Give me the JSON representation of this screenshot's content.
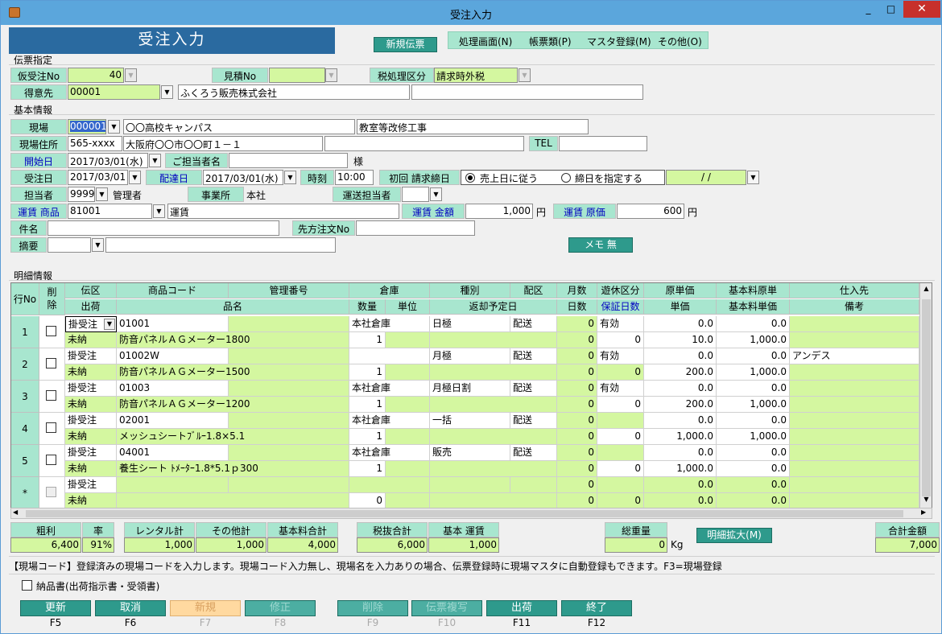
{
  "window": {
    "title": "受注入力",
    "minimize": "_",
    "maximize": "□",
    "close": "✕"
  },
  "header": {
    "banner": "受注入力",
    "new_slip": "新規伝票"
  },
  "menu": [
    "処理画面(N)",
    "帳票類(P)",
    "マスタ登録(M)",
    "その他(O)"
  ],
  "sections": {
    "slip": "伝票指定",
    "basic": "基本情報",
    "detail": "明細情報"
  },
  "slip": {
    "temp_order_no_label": "仮受注No",
    "temp_order_no": "40",
    "estimate_no_label": "見積No",
    "estimate_no": "",
    "tax_label": "税処理区分",
    "tax_value": "請求時外税",
    "customer_label": "得意先",
    "customer_code": "00001",
    "customer_name": "ふくろう販売株式会社",
    "customer_extra": ""
  },
  "basic": {
    "site_label": "現場",
    "site_code": "000001",
    "site_name": "〇〇高校キャンパス",
    "site_work": "教室等改修工事",
    "site_addr_label": "現場住所",
    "zip": "565-xxxx",
    "address": "大阪府〇〇市〇〇町１－１",
    "address2": "",
    "tel_label": "TEL",
    "tel": "",
    "start_label": "開始日",
    "start_date": "2017/03/01(水)",
    "contact_label": "ご担当者名",
    "contact": "",
    "honorific": "様",
    "order_date_label": "受注日",
    "order_date": "2017/03/01",
    "delivery_label": "配達日",
    "delivery_date": "2017/03/01(水)",
    "time_label": "時刻",
    "time": "10:00",
    "billing_label": "初回 請求締日",
    "billing_opt1": "売上日に従う",
    "billing_opt2": "締日を指定する",
    "billing_date": "/  /",
    "staff_label": "担当者",
    "staff_code": "9999",
    "staff_name": "管理者",
    "office_label": "事業所",
    "office": "本社",
    "transport_staff_label": "運送担当者",
    "transport_staff": "",
    "fare_item_label": "運賃 商品",
    "fare_item_code": "81001",
    "fare_item_name": "運賃",
    "fare_amount_label": "運賃 金額",
    "fare_amount": "1,000",
    "yen1": "円",
    "fare_cost_label": "運賃 原価",
    "fare_cost": "600",
    "yen2": "円",
    "subject_label": "件名",
    "subject": "",
    "dest_order_label": "先方注文No",
    "dest_order": "",
    "summary_label": "摘要",
    "summary": "",
    "memo_button": "メモ 無"
  },
  "grid": {
    "hdr_row": "行No",
    "hdr_del": "削\n除",
    "hdr1": [
      "伝区",
      "商品コード",
      "管理番号",
      "倉庫",
      "種別",
      "配区",
      "月数",
      "遊休区分",
      "原単価",
      "基本料原単",
      "仕入先"
    ],
    "hdr2": [
      "出荷",
      "品名",
      "数量",
      "単位",
      "返却予定日",
      "日数",
      "保証日数",
      "単価",
      "基本料単価",
      "備考"
    ],
    "rows": [
      {
        "no": "1",
        "kubun": "掛受注",
        "code": "01001",
        "mgmt": "",
        "warehouse": "本社倉庫",
        "kind": "日極",
        "haiku": "配送",
        "months": "0",
        "idle": "有効",
        "cost": "0.0",
        "basecost": "0.0",
        "supplier": "",
        "ship": "未納",
        "name": "防音パネルＡＧメーター1800",
        "qty": "1",
        "unit": "",
        "ret": "",
        "days": "0",
        "guar": "0",
        "price": "10.0",
        "baseprice": "1,000.0",
        "note": ""
      },
      {
        "no": "2",
        "kubun": "掛受注",
        "code": "01002W",
        "mgmt": "",
        "warehouse": "",
        "kind": "月極",
        "haiku": "配送",
        "months": "0",
        "idle": "有効",
        "cost": "0.0",
        "basecost": "0.0",
        "supplier": "アンデス",
        "ship": "未納",
        "name": "防音パネルＡＧメーター1500",
        "qty": "1",
        "unit": "",
        "ret": "",
        "days": "0",
        "guar": "0",
        "price": "200.0",
        "baseprice": "1,000.0",
        "note": ""
      },
      {
        "no": "3",
        "kubun": "掛受注",
        "code": "01003",
        "mgmt": "",
        "warehouse": "本社倉庫",
        "kind": "月極日割",
        "haiku": "配送",
        "months": "0",
        "idle": "有効",
        "cost": "0.0",
        "basecost": "0.0",
        "supplier": "",
        "ship": "未納",
        "name": "防音パネルＡＧメーター1200",
        "qty": "1",
        "unit": "",
        "ret": "",
        "days": "0",
        "guar": "0",
        "price": "200.0",
        "baseprice": "1,000.0",
        "note": ""
      },
      {
        "no": "4",
        "kubun": "掛受注",
        "code": "02001",
        "mgmt": "",
        "warehouse": "本社倉庫",
        "kind": "一括",
        "haiku": "配送",
        "months": "0",
        "idle": "",
        "cost": "0.0",
        "basecost": "0.0",
        "supplier": "",
        "ship": "未納",
        "name": "メッシュシートﾌﾞﾙｰ1.8×5.1",
        "qty": "1",
        "unit": "",
        "ret": "",
        "days": "0",
        "guar": "0",
        "price": "1,000.0",
        "baseprice": "1,000.0",
        "note": ""
      },
      {
        "no": "5",
        "kubun": "掛受注",
        "code": "04001",
        "mgmt": "",
        "warehouse": "本社倉庫",
        "kind": "販売",
        "haiku": "配送",
        "months": "0",
        "idle": "",
        "cost": "0.0",
        "basecost": "0.0",
        "supplier": "",
        "ship": "未納",
        "name": "養生シート ﾄﾒｰﾀｰ1.8*5.1ｐ300",
        "qty": "1",
        "unit": "",
        "ret": "",
        "days": "0",
        "guar": "0",
        "price": "1,000.0",
        "baseprice": "0.0",
        "note": ""
      },
      {
        "no": "*",
        "kubun": "掛受注",
        "code": "",
        "mgmt": "",
        "warehouse": "",
        "kind": "",
        "haiku": "",
        "months": "0",
        "idle": "",
        "cost": "0.0",
        "basecost": "0.0",
        "supplier": "",
        "ship": "未納",
        "name": "",
        "qty": "0",
        "unit": "",
        "ret": "",
        "days": "0",
        "guar": "0",
        "price": "0.0",
        "baseprice": "0.0",
        "note": ""
      }
    ]
  },
  "totals": {
    "gross_label": "粗利",
    "gross": "6,400",
    "rate_label": "率",
    "rate": "91%",
    "rental_label": "レンタル計",
    "rental": "1,000",
    "other_label": "その他計",
    "other": "1,000",
    "base_label": "基本料合計",
    "base": "4,000",
    "pretax_label": "税抜合計",
    "pretax": "6,000",
    "basefare_label": "基本 運賃",
    "basefare": "1,000",
    "weight_label": "総重量",
    "weight": "0",
    "kg": "Kg",
    "expand_button": "明細拡大(M)",
    "total_label": "合計金額",
    "total": "7,000"
  },
  "status": "【現場コード】登録済みの現場コードを入力します。現場コード入力無し、現場名を入力ありの場合、伝票登録時に現場マスタに自動登録もできます。F3=現場登録",
  "delivery_note": "納品書(出荷指示書・受領書)",
  "fkeys": [
    {
      "label": "更新",
      "key": "F5"
    },
    {
      "label": "取消",
      "key": "F6"
    },
    {
      "label": "新規",
      "key": "F7"
    },
    {
      "label": "修正",
      "key": "F8"
    },
    {
      "label": "削除",
      "key": "F9"
    },
    {
      "label": "伝票複写",
      "key": "F10"
    },
    {
      "label": "出荷",
      "key": "F11"
    },
    {
      "label": "終了",
      "key": "F12"
    }
  ]
}
